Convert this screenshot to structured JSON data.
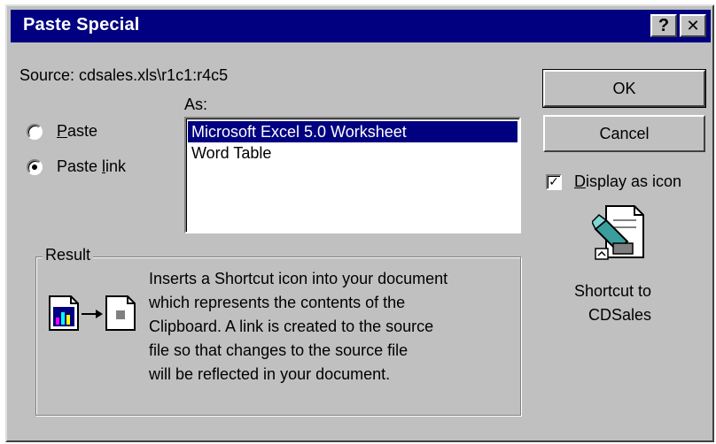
{
  "dialog": {
    "title": "Paste Special",
    "help_button": "?",
    "close_button": "✕"
  },
  "source": {
    "label": "Source: cdsales.xls\\r1c1:r4c5"
  },
  "as": {
    "label": "As:",
    "items": [
      {
        "label": "Microsoft Excel 5.0 Worksheet",
        "selected": true
      },
      {
        "label": "Word Table",
        "selected": false
      }
    ]
  },
  "options": {
    "paste": {
      "label": "Paste",
      "checked": false
    },
    "paste_link": {
      "label": "Paste link",
      "checked": true
    }
  },
  "buttons": {
    "ok": "OK",
    "cancel": "Cancel"
  },
  "display_as_icon": {
    "label": "Display as icon",
    "checked": true
  },
  "icon_caption": {
    "line1": "Shortcut to",
    "line2": "CDSales"
  },
  "result": {
    "label": "Result",
    "lines": [
      "Inserts a Shortcut icon into your document",
      "which represents the contents of the",
      "Clipboard. A link is created to the source",
      "file so that changes to the source file",
      "will be reflected in your document."
    ]
  },
  "colors": {
    "titlebar": "#000080",
    "face": "#c0c0c0",
    "selection": "#000080"
  }
}
